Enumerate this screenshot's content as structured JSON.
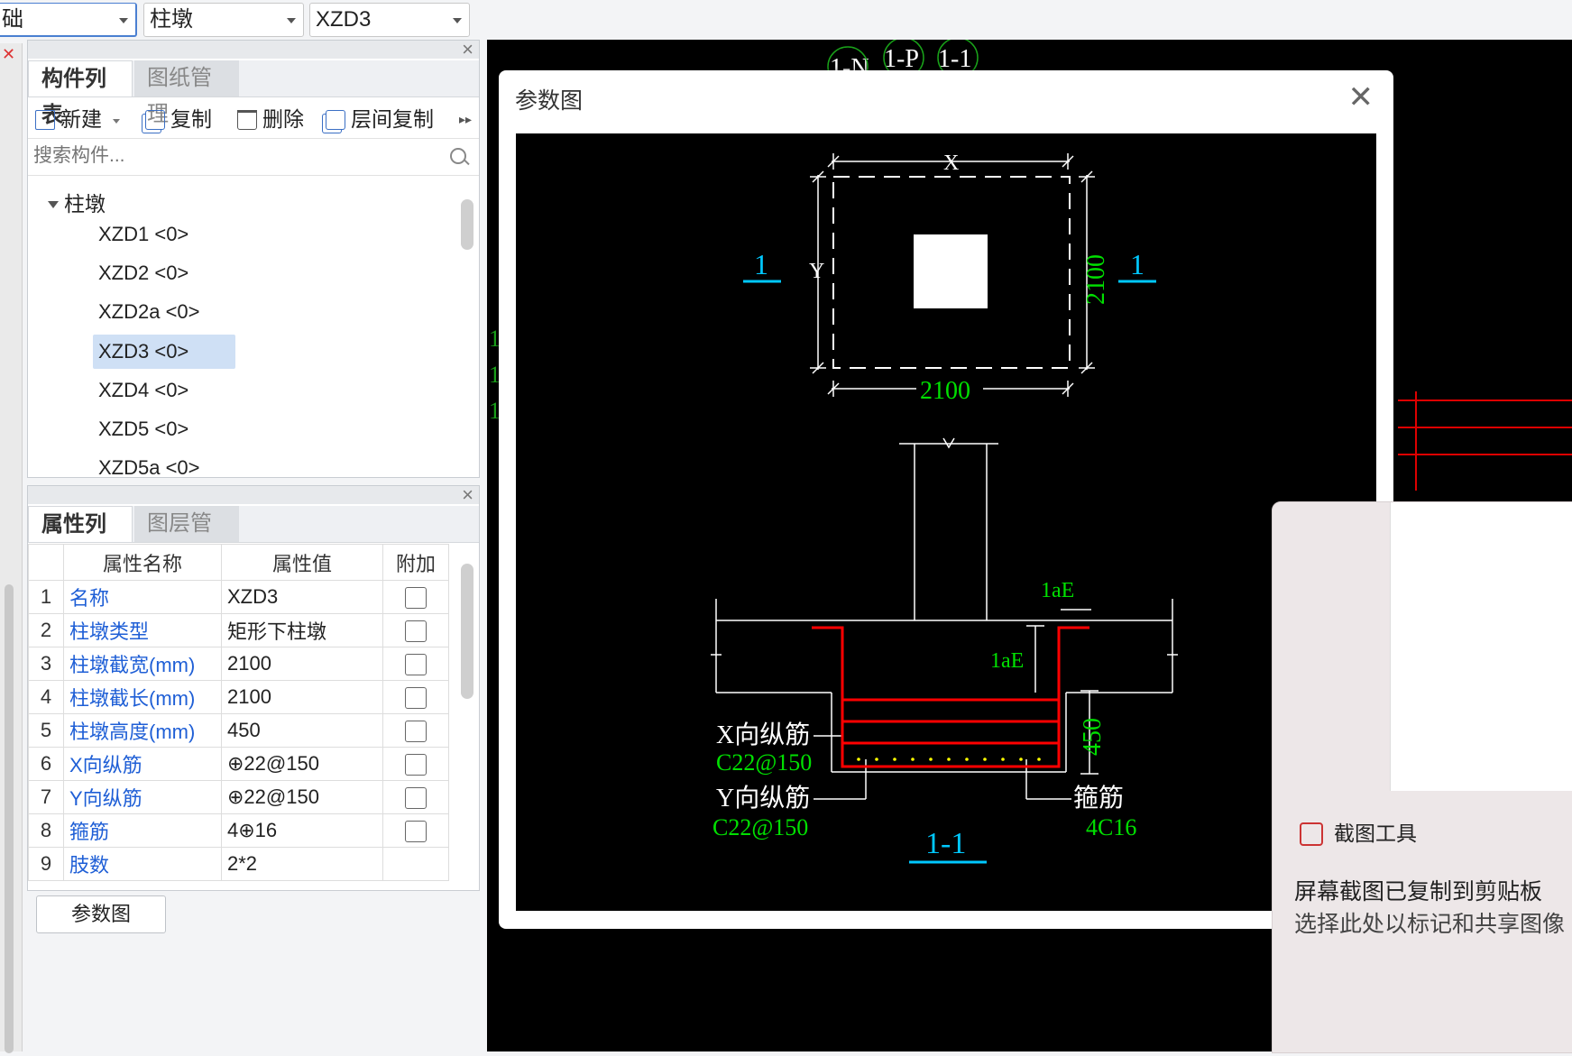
{
  "top_bar": {
    "dropdown1": "基础",
    "dropdown1_visible": "础",
    "dropdown2": "柱墩",
    "dropdown3": "XZD3"
  },
  "component_panel": {
    "tabs": [
      "构件列表",
      "图纸管理"
    ],
    "toolbar": {
      "new": "新建",
      "copy": "复制",
      "delete": "删除",
      "floor_copy": "层间复制"
    },
    "search_placeholder": "搜索构件...",
    "tree_root": "柱墩",
    "items": [
      "XZD1 <0>",
      "XZD2 <0>",
      "XZD2a <0>",
      "XZD3 <0>",
      "XZD4 <0>",
      "XZD5 <0>",
      "XZD5a <0>"
    ],
    "selected_index": 3
  },
  "property_panel": {
    "tabs": [
      "属性列表",
      "图层管理"
    ],
    "headers": [
      "属性名称",
      "属性值",
      "附加"
    ],
    "rows": [
      {
        "n": "1",
        "name": "名称",
        "value": "XZD3"
      },
      {
        "n": "2",
        "name": "柱墩类型",
        "value": "矩形下柱墩"
      },
      {
        "n": "3",
        "name": "柱墩截宽(mm)",
        "value": "2100"
      },
      {
        "n": "4",
        "name": "柱墩截长(mm)",
        "value": "2100"
      },
      {
        "n": "5",
        "name": "柱墩高度(mm)",
        "value": "450"
      },
      {
        "n": "6",
        "name": "X向纵筋",
        "value": "⊕22@150"
      },
      {
        "n": "7",
        "name": "Y向纵筋",
        "value": "⊕22@150"
      },
      {
        "n": "8",
        "name": "箍筋",
        "value": "4⊕16"
      },
      {
        "n": "9",
        "name": "肢数",
        "value": "2*2"
      }
    ],
    "param_button": "参数图"
  },
  "dialog": {
    "title": "参数图",
    "cad_background_labels": [
      "1-N",
      "1-P",
      "1-1"
    ],
    "drawing": {
      "plan": {
        "label_x": "X",
        "label_y": "Y",
        "width": "2100",
        "height": "2100",
        "section_mark": "1"
      },
      "section": {
        "title": "1-1",
        "lae_top": "1aE",
        "lae_side": "1aE",
        "height": "450",
        "x_bar_label": "X向纵筋",
        "x_bar_spec": "C22@150",
        "y_bar_label": "Y向纵筋",
        "y_bar_spec": "C22@150",
        "stirrup_label": "箍筋",
        "stirrup_spec": "4C16"
      }
    }
  },
  "notification": {
    "app": "截图工具",
    "line1": "屏幕截图已复制到剪贴板",
    "line2": "选择此处以标记和共享图像"
  },
  "colors": {
    "accent": "#1f5fd6",
    "cad_green": "#00e000",
    "cad_cyan": "#00c8ff",
    "cad_red": "#ff0000",
    "selection": "#cfe0f5"
  }
}
